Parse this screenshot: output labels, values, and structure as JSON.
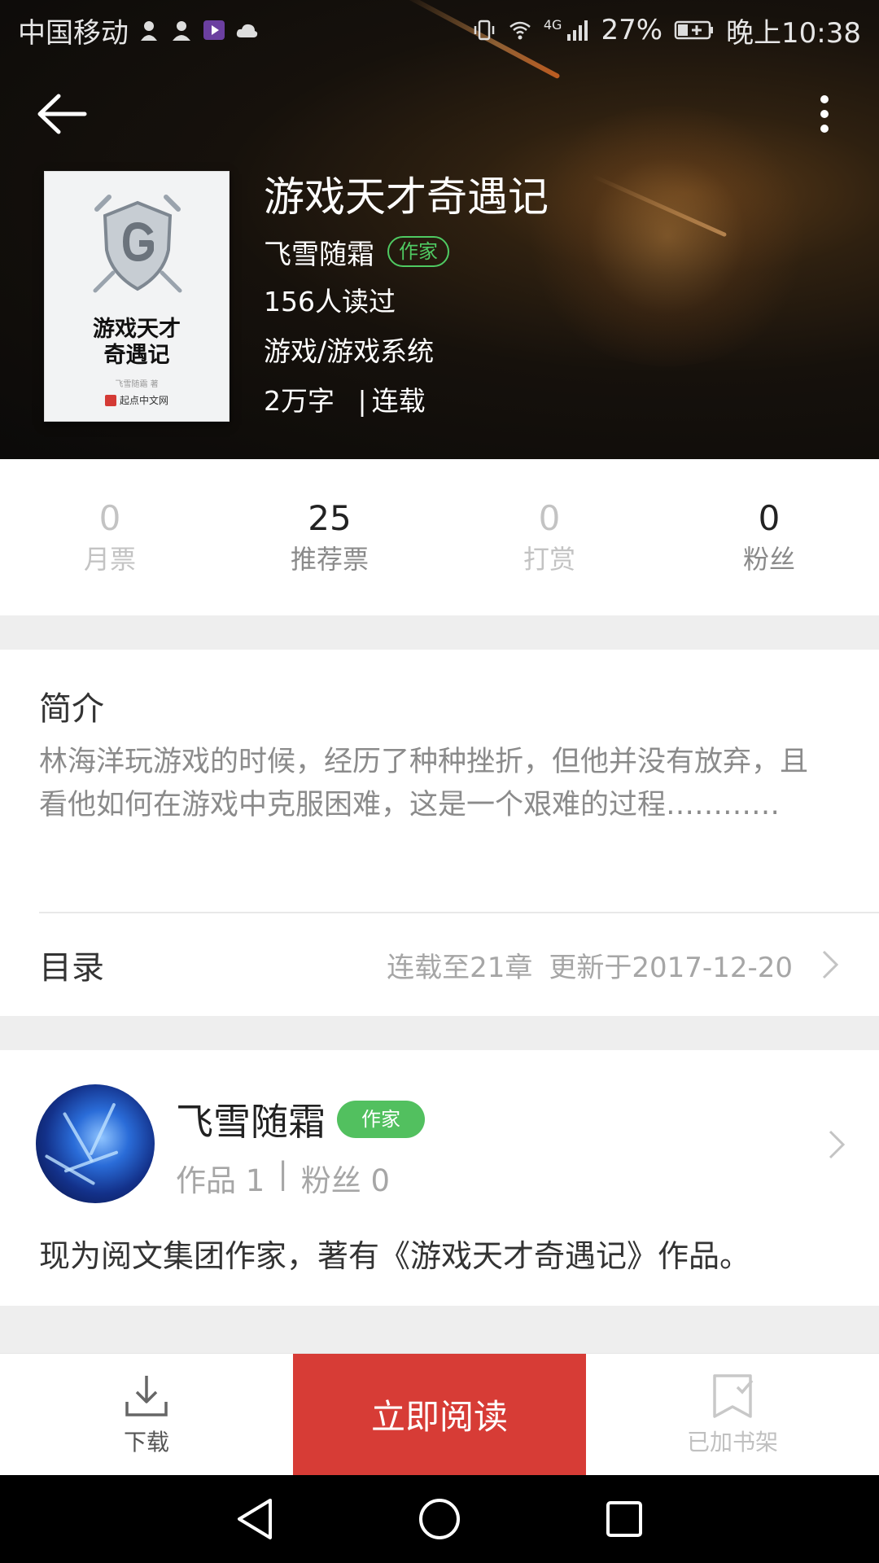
{
  "status_bar": {
    "carrier": "中国移动",
    "network": "4G",
    "battery": "27%",
    "time": "晚上10:38"
  },
  "book": {
    "title": "游戏天才奇遇记",
    "author": "飞雪随霜",
    "author_badge": "作家",
    "readers": "156人读过",
    "category": "游戏/游戏系统",
    "word_count": "2万字",
    "separator": "|",
    "status": "连载",
    "cover": {
      "title_line1": "游戏天才",
      "title_line2": "奇遇记",
      "author_small": "飞雪随霜 著",
      "publisher": "起点中文网"
    }
  },
  "stats": [
    {
      "value": "0",
      "label": "月票"
    },
    {
      "value": "25",
      "label": "推荐票"
    },
    {
      "value": "0",
      "label": "打赏"
    },
    {
      "value": "0",
      "label": "粉丝"
    }
  ],
  "intro": {
    "heading": "简介",
    "text": "林海洋玩游戏的时候，经历了种种挫折，但他并没有放弃，且看他如何在游戏中克服困难，这是一个艰难的过程…………"
  },
  "toc": {
    "label": "目录",
    "chapters": "连载至21章",
    "updated": "更新于2017-12-20"
  },
  "author_card": {
    "name": "飞雪随霜",
    "badge": "作家",
    "works": "作品 1",
    "separator": "|",
    "fans": "粉丝 0",
    "bio": "现为阅文集团作家，著有《游戏天才奇遇记》作品。"
  },
  "bottom_bar": {
    "download_label": "下载",
    "read_label": "立即阅读",
    "shelf_label": "已加书架"
  },
  "colors": {
    "accent_red": "#d73c36",
    "badge_green": "#52c05f"
  },
  "icons": [
    "back-arrow-icon",
    "more-vertical-icon",
    "download-icon",
    "bookshelf-check-icon",
    "chevron-right-icon",
    "nav-back-icon",
    "nav-home-icon",
    "nav-recents-icon"
  ]
}
